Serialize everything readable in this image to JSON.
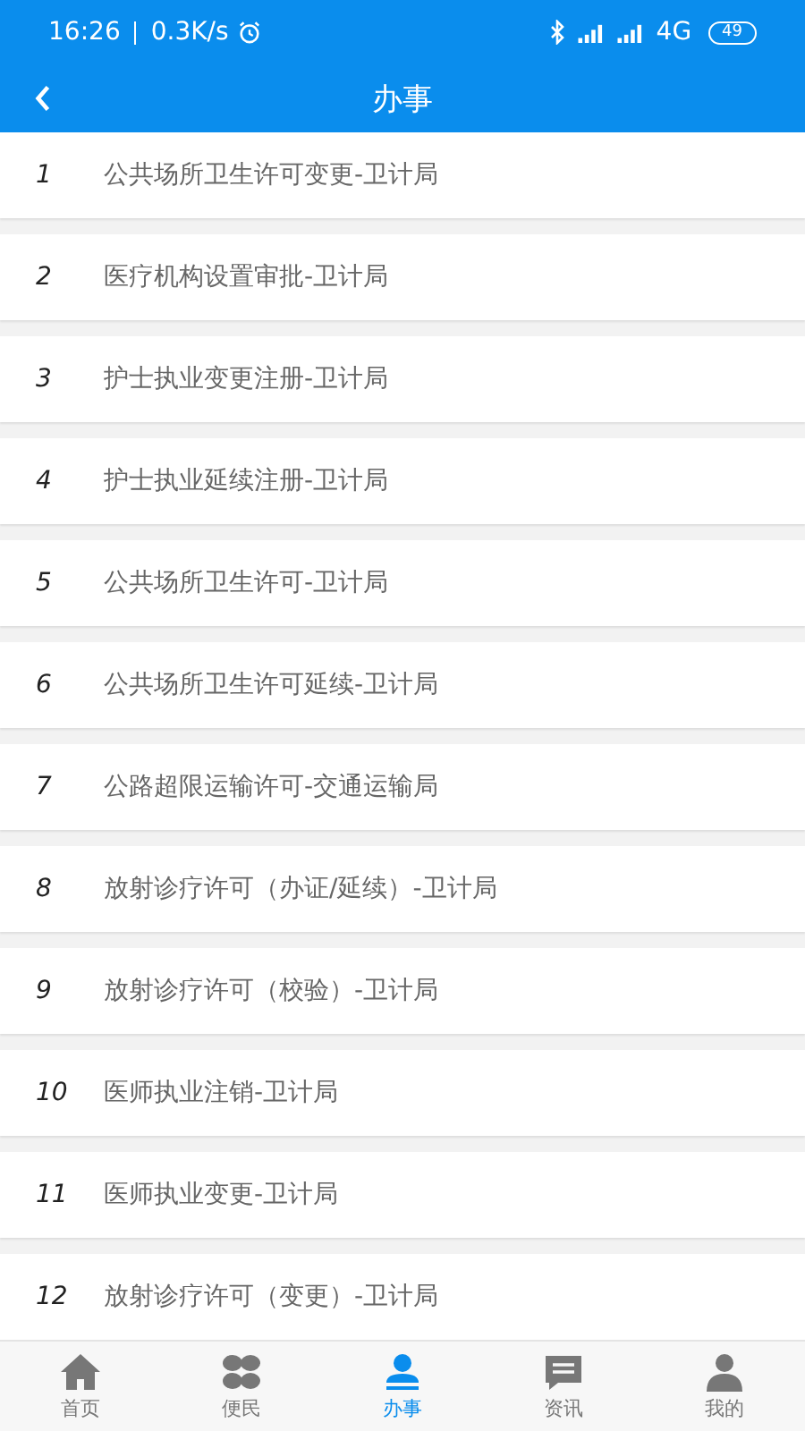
{
  "status_bar": {
    "time": "16:26",
    "speed": "0.3K/s",
    "network": "4G",
    "battery": "49"
  },
  "header": {
    "title": "办事"
  },
  "items": [
    {
      "number": "1",
      "label": "公共场所卫生许可变更-卫计局"
    },
    {
      "number": "2",
      "label": "医疗机构设置审批-卫计局"
    },
    {
      "number": "3",
      "label": "护士执业变更注册-卫计局"
    },
    {
      "number": "4",
      "label": "护士执业延续注册-卫计局"
    },
    {
      "number": "5",
      "label": "公共场所卫生许可-卫计局"
    },
    {
      "number": "6",
      "label": "公共场所卫生许可延续-卫计局"
    },
    {
      "number": "7",
      "label": "公路超限运输许可-交通运输局"
    },
    {
      "number": "8",
      "label": "放射诊疗许可（办证/延续）-卫计局"
    },
    {
      "number": "9",
      "label": "放射诊疗许可（校验）-卫计局"
    },
    {
      "number": "10",
      "label": "医师执业注销-卫计局"
    },
    {
      "number": "11",
      "label": "医师执业变更-卫计局"
    },
    {
      "number": "12",
      "label": "放射诊疗许可（变更）-卫计局"
    }
  ],
  "tabs": [
    {
      "kind": "home",
      "label": "首页",
      "selected": false
    },
    {
      "kind": "clover",
      "label": "便民",
      "selected": false
    },
    {
      "kind": "stamp",
      "label": "办事",
      "selected": true
    },
    {
      "kind": "message",
      "label": "资讯",
      "selected": false
    },
    {
      "kind": "person",
      "label": "我的",
      "selected": false
    }
  ]
}
